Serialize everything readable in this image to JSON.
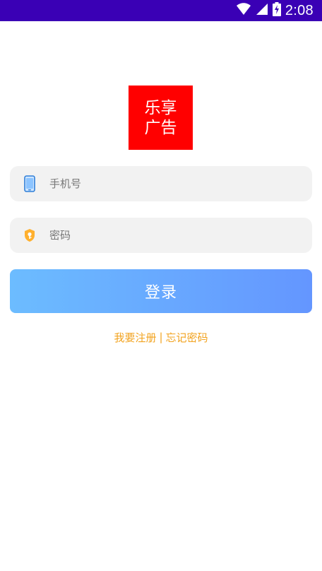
{
  "status_bar": {
    "time": "2:08",
    "icons": [
      "wifi-icon",
      "cellular-signal-icon",
      "battery-charging-icon"
    ],
    "background": "#3a00b5"
  },
  "logo": {
    "line1": "乐享",
    "line2": "广告",
    "background": "#ff0000"
  },
  "phone_field": {
    "placeholder": "手机号",
    "value": "",
    "icon": "phone-icon"
  },
  "password_field": {
    "placeholder": "密码",
    "value": "",
    "icon": "key-icon"
  },
  "login_button": {
    "label": "登录",
    "gradient": [
      "#6cbcff",
      "#6496ff"
    ]
  },
  "links": {
    "register": "我要注册",
    "separator": "|",
    "forgot": "忘记密码",
    "color": "#f2a31f"
  }
}
